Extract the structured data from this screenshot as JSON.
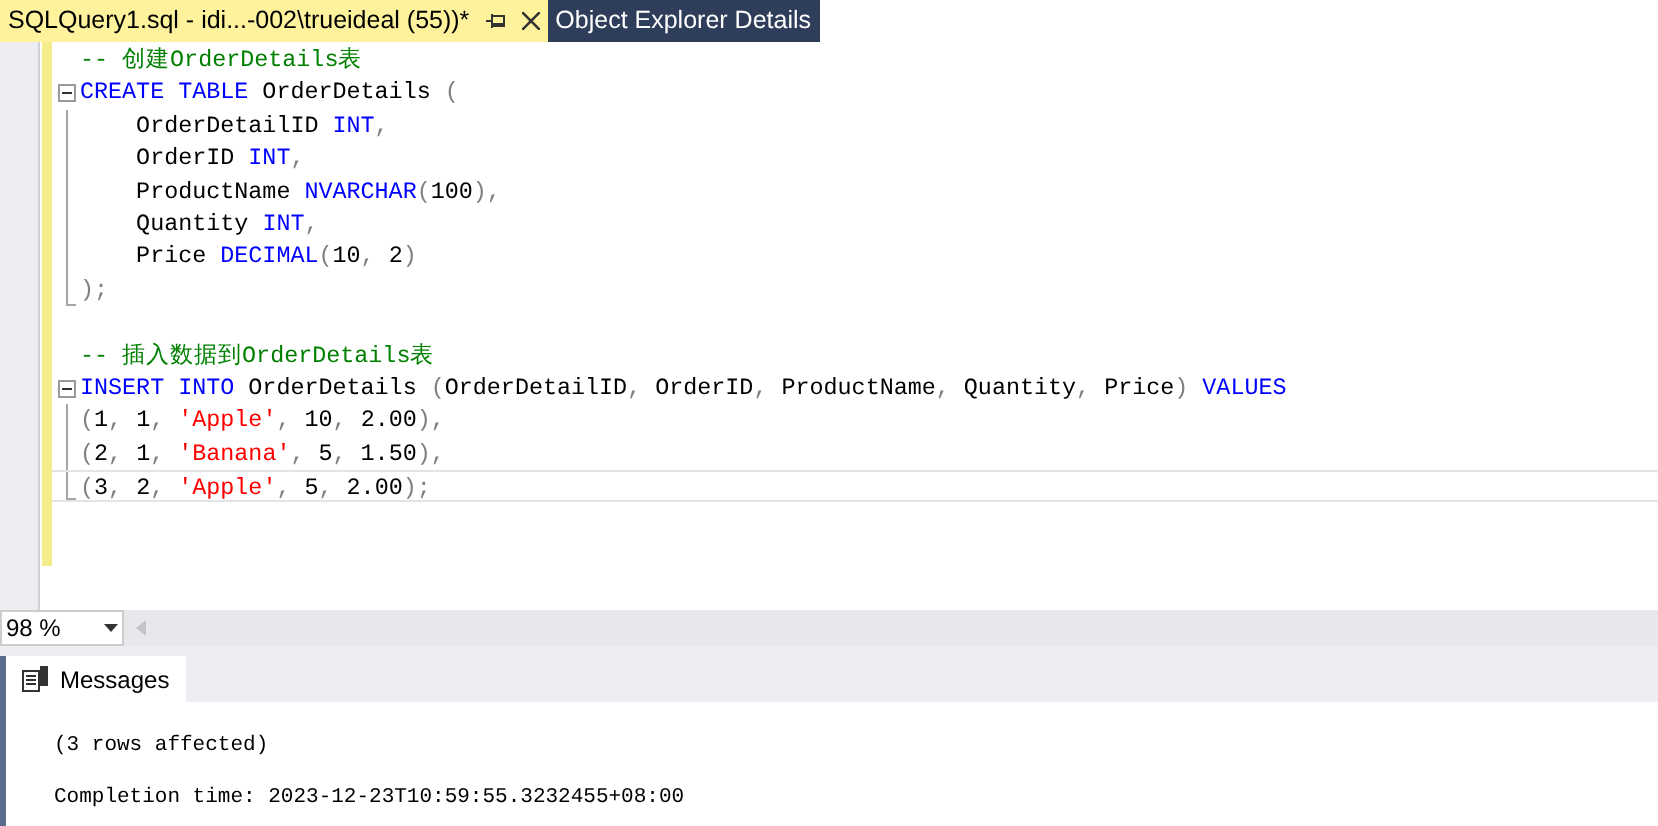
{
  "tabs": [
    {
      "label": "SQLQuery1.sql - idi...-002\\trueideal (55))*",
      "selected": true
    },
    {
      "label": "Object Explorer Details",
      "selected": false
    }
  ],
  "editor": {
    "lines": [
      {
        "kind": "plain",
        "current": false,
        "tokens": [
          {
            "kind": "comment",
            "text": "-- 创建OrderDetails表"
          }
        ]
      },
      {
        "kind": "fold_start",
        "current": false,
        "tokens": [
          {
            "kind": "keyword",
            "text": "CREATE TABLE"
          },
          {
            "kind": "plain",
            "text": " OrderDetails "
          },
          {
            "kind": "punct",
            "text": "("
          }
        ]
      },
      {
        "kind": "fold_inner",
        "current": false,
        "tokens": [
          {
            "kind": "plain",
            "text": "    OrderDetailID "
          },
          {
            "kind": "keyword",
            "text": "INT"
          },
          {
            "kind": "punct",
            "text": ","
          }
        ]
      },
      {
        "kind": "fold_inner",
        "current": false,
        "tokens": [
          {
            "kind": "plain",
            "text": "    OrderID "
          },
          {
            "kind": "keyword",
            "text": "INT"
          },
          {
            "kind": "punct",
            "text": ","
          }
        ]
      },
      {
        "kind": "fold_inner",
        "current": false,
        "tokens": [
          {
            "kind": "plain",
            "text": "    ProductName "
          },
          {
            "kind": "keyword",
            "text": "NVARCHAR"
          },
          {
            "kind": "punct",
            "text": "("
          },
          {
            "kind": "plain",
            "text": "100"
          },
          {
            "kind": "punct",
            "text": "),"
          }
        ]
      },
      {
        "kind": "fold_inner",
        "current": false,
        "tokens": [
          {
            "kind": "plain",
            "text": "    Quantity "
          },
          {
            "kind": "keyword",
            "text": "INT"
          },
          {
            "kind": "punct",
            "text": ","
          }
        ]
      },
      {
        "kind": "fold_inner",
        "current": false,
        "tokens": [
          {
            "kind": "plain",
            "text": "    Price "
          },
          {
            "kind": "keyword",
            "text": "DECIMAL"
          },
          {
            "kind": "punct",
            "text": "("
          },
          {
            "kind": "plain",
            "text": "10"
          },
          {
            "kind": "punct",
            "text": ", "
          },
          {
            "kind": "plain",
            "text": "2"
          },
          {
            "kind": "punct",
            "text": ")"
          }
        ]
      },
      {
        "kind": "fold_end",
        "current": false,
        "tokens": [
          {
            "kind": "punct",
            "text": ");"
          }
        ]
      },
      {
        "kind": "blank",
        "current": false
      },
      {
        "kind": "plain",
        "current": false,
        "tokens": [
          {
            "kind": "comment",
            "text": "-- 插入数据到OrderDetails表"
          }
        ]
      },
      {
        "kind": "fold_start",
        "current": false,
        "tokens": [
          {
            "kind": "keyword",
            "text": "INSERT INTO"
          },
          {
            "kind": "plain",
            "text": " OrderDetails "
          },
          {
            "kind": "punct",
            "text": "("
          },
          {
            "kind": "plain",
            "text": "OrderDetailID"
          },
          {
            "kind": "punct",
            "text": ", "
          },
          {
            "kind": "plain",
            "text": "OrderID"
          },
          {
            "kind": "punct",
            "text": ", "
          },
          {
            "kind": "plain",
            "text": "ProductName"
          },
          {
            "kind": "punct",
            "text": ", "
          },
          {
            "kind": "plain",
            "text": "Quantity"
          },
          {
            "kind": "punct",
            "text": ", "
          },
          {
            "kind": "plain",
            "text": "Price"
          },
          {
            "kind": "punct",
            "text": ") "
          },
          {
            "kind": "keyword",
            "text": "VALUES"
          }
        ]
      },
      {
        "kind": "fold_inner",
        "current": false,
        "tokens": [
          {
            "kind": "punct",
            "text": "("
          },
          {
            "kind": "plain",
            "text": "1"
          },
          {
            "kind": "punct",
            "text": ", "
          },
          {
            "kind": "plain",
            "text": "1"
          },
          {
            "kind": "punct",
            "text": ", "
          },
          {
            "kind": "string",
            "text": "'Apple'"
          },
          {
            "kind": "punct",
            "text": ", "
          },
          {
            "kind": "plain",
            "text": "10"
          },
          {
            "kind": "punct",
            "text": ", "
          },
          {
            "kind": "plain",
            "text": "2.00"
          },
          {
            "kind": "punct",
            "text": "),"
          }
        ]
      },
      {
        "kind": "fold_inner",
        "current": false,
        "tokens": [
          {
            "kind": "punct",
            "text": "("
          },
          {
            "kind": "plain",
            "text": "2"
          },
          {
            "kind": "punct",
            "text": ", "
          },
          {
            "kind": "plain",
            "text": "1"
          },
          {
            "kind": "punct",
            "text": ", "
          },
          {
            "kind": "string",
            "text": "'Banana'"
          },
          {
            "kind": "punct",
            "text": ", "
          },
          {
            "kind": "plain",
            "text": "5"
          },
          {
            "kind": "punct",
            "text": ", "
          },
          {
            "kind": "plain",
            "text": "1.50"
          },
          {
            "kind": "punct",
            "text": "),"
          }
        ]
      },
      {
        "kind": "fold_end",
        "current": true,
        "tokens": [
          {
            "kind": "punct",
            "text": "("
          },
          {
            "kind": "plain",
            "text": "3"
          },
          {
            "kind": "punct",
            "text": ", "
          },
          {
            "kind": "plain",
            "text": "2"
          },
          {
            "kind": "punct",
            "text": ", "
          },
          {
            "kind": "string",
            "text": "'Apple'"
          },
          {
            "kind": "punct",
            "text": ", "
          },
          {
            "kind": "plain",
            "text": "5"
          },
          {
            "kind": "punct",
            "text": ", "
          },
          {
            "kind": "plain",
            "text": "2.00"
          },
          {
            "kind": "punct",
            "text": ");"
          }
        ]
      }
    ]
  },
  "zoom": {
    "value": "98 %"
  },
  "results_tab": {
    "label": "Messages"
  },
  "messages": [
    "(3 rows affected)",
    "Completion time: 2023-12-23T10:59:55.3232455+08:00"
  ]
}
